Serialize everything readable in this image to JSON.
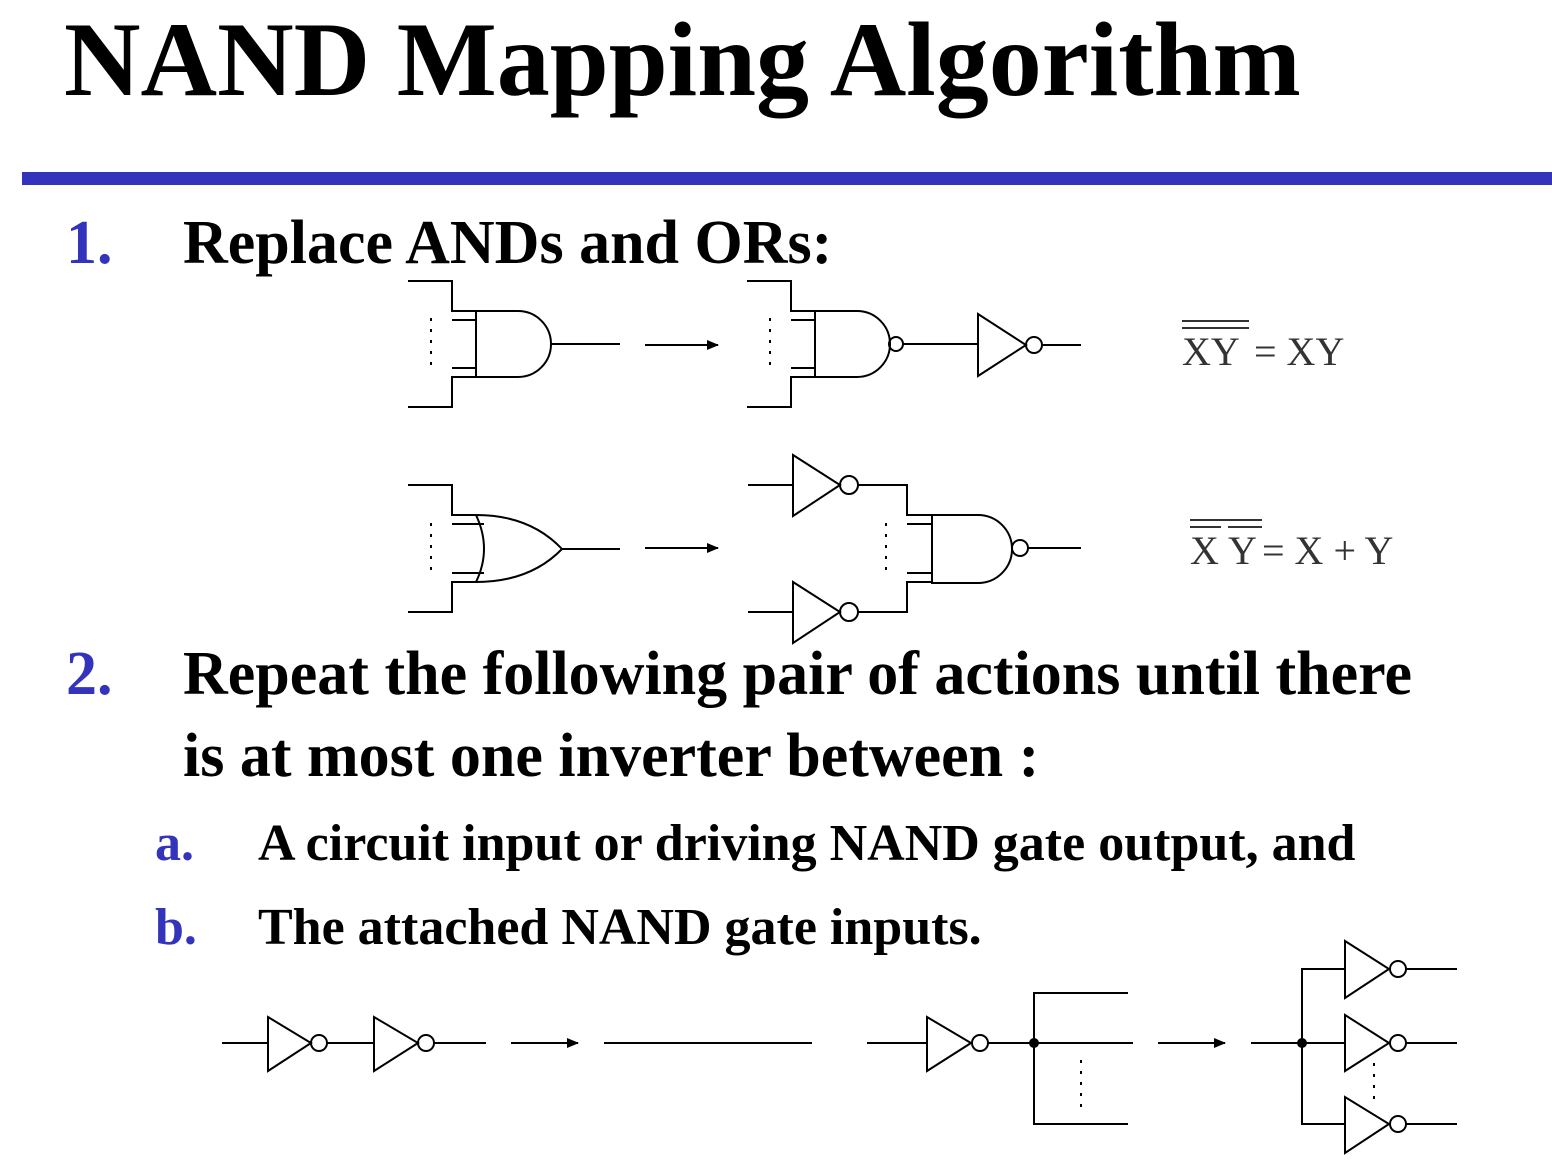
{
  "title": "NAND Mapping Algorithm",
  "steps": [
    {
      "number": "1.",
      "text": "Replace ANDs and ORs:"
    },
    {
      "number": "2.",
      "line1": "Repeat the following pair of actions until there",
      "line2": "is at most one inverter between :"
    }
  ],
  "substeps": [
    {
      "letter": "a.",
      "text": "A circuit input or driving NAND gate output, and"
    },
    {
      "letter": "b.",
      "text": "The attached NAND gate inputs."
    }
  ],
  "equations": {
    "and": {
      "lhs": "XY",
      "rhs": "= XY"
    },
    "or": {
      "lhs_x": "X",
      "lhs_y": "Y",
      "rhs": "= X + Y"
    }
  },
  "colors": {
    "accent": "#3333bb"
  }
}
